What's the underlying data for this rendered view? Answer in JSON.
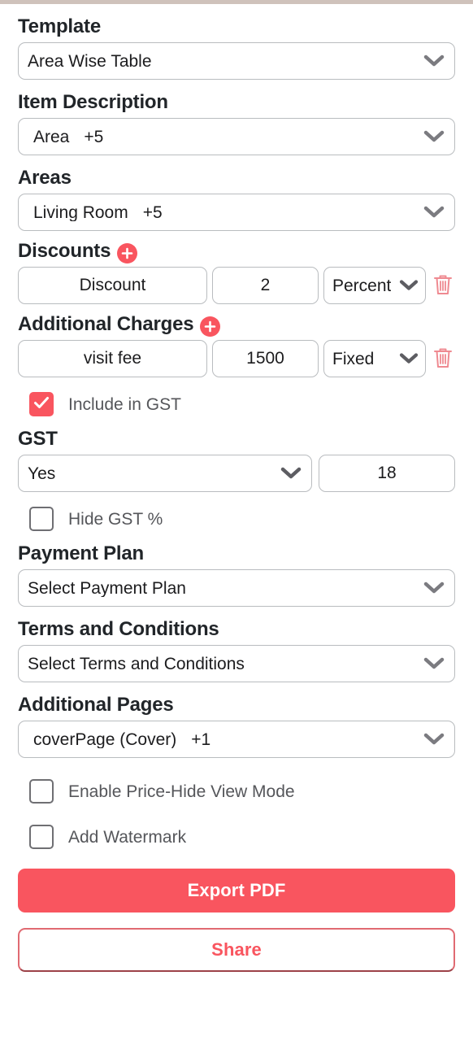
{
  "accent_color": "#f9555f",
  "form": {
    "template": {
      "label": "Template",
      "value": "Area Wise Table",
      "icon": "chevron-down-icon"
    },
    "item_description": {
      "label": "Item Description",
      "value": "Area",
      "extra_count": "+5",
      "icon": "chevron-down-icon"
    },
    "areas": {
      "label": "Areas",
      "value": "Living Room",
      "extra_count": "+5",
      "icon": "chevron-down-icon"
    },
    "discounts": {
      "label": "Discounts",
      "add_icon": "plus-circle-icon",
      "rows": [
        {
          "name": "Discount",
          "amount": "2",
          "type": "Percent",
          "delete_icon": "trash-icon"
        }
      ]
    },
    "additional_charges": {
      "label": "Additional Charges",
      "add_icon": "plus-circle-icon",
      "rows": [
        {
          "name": "visit fee",
          "amount": "1500",
          "type": "Fixed",
          "delete_icon": "trash-icon"
        }
      ],
      "include_in_gst": {
        "label": "Include in GST",
        "checked": true
      }
    },
    "gst": {
      "label": "GST",
      "enabled_value": "Yes",
      "percent_value": "18",
      "icon": "chevron-down-icon",
      "hide_gst_percent": {
        "label": "Hide GST %",
        "checked": false
      }
    },
    "payment_plan": {
      "label": "Payment Plan",
      "value": "Select Payment Plan",
      "icon": "chevron-down-icon"
    },
    "terms_and_conditions": {
      "label": "Terms and Conditions",
      "value": "Select Terms and Conditions",
      "icon": "chevron-down-icon"
    },
    "additional_pages": {
      "label": "Additional Pages",
      "value": "coverPage (Cover)",
      "extra_count": "+1",
      "icon": "chevron-down-icon"
    },
    "price_hide_view_mode": {
      "label": "Enable Price-Hide View Mode",
      "checked": false
    },
    "add_watermark": {
      "label": "Add Watermark",
      "checked": false
    }
  },
  "actions": {
    "export_pdf": "Export PDF",
    "share": "Share"
  }
}
